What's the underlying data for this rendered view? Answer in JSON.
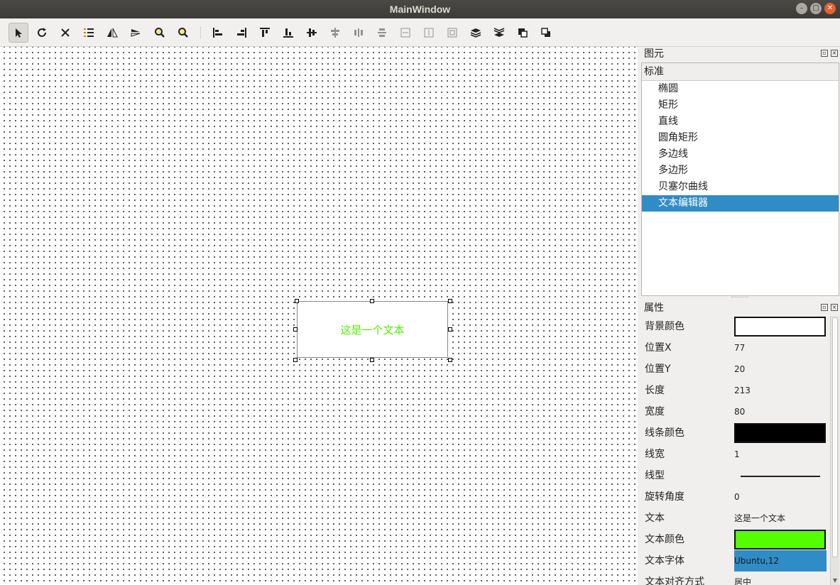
{
  "window": {
    "title": "MainWindow"
  },
  "toolbar": {
    "buttons": [
      {
        "icon": "select-arrow-icon",
        "active": true,
        "disabled": false
      },
      {
        "icon": "rotate-icon",
        "active": false,
        "disabled": false
      },
      {
        "icon": "delete-icon",
        "active": false,
        "disabled": false
      },
      {
        "icon": "list-icon",
        "active": false,
        "disabled": false
      },
      {
        "icon": "flip-horizontal-icon",
        "active": false,
        "disabled": false
      },
      {
        "icon": "flip-vertical-icon",
        "active": false,
        "disabled": false
      },
      {
        "icon": "zoom-in-icon",
        "active": false,
        "disabled": false
      },
      {
        "icon": "zoom-out-icon",
        "active": false,
        "disabled": false
      },
      {
        "icon": "align-left-icon",
        "active": false,
        "disabled": false
      },
      {
        "icon": "align-right-icon",
        "active": false,
        "disabled": false
      },
      {
        "icon": "align-top-icon",
        "active": false,
        "disabled": false
      },
      {
        "icon": "align-bottom-icon",
        "active": false,
        "disabled": false
      },
      {
        "icon": "align-horizontal-center-icon",
        "active": false,
        "disabled": false
      },
      {
        "icon": "align-vertical-center-icon",
        "active": false,
        "disabled": true
      },
      {
        "icon": "distribute-horizontal-icon",
        "active": false,
        "disabled": true
      },
      {
        "icon": "distribute-vertical-icon",
        "active": false,
        "disabled": true
      },
      {
        "icon": "same-width-icon",
        "active": false,
        "disabled": true
      },
      {
        "icon": "same-height-icon",
        "active": false,
        "disabled": true
      },
      {
        "icon": "same-size-icon",
        "active": false,
        "disabled": true
      },
      {
        "icon": "bring-to-front-icon",
        "active": false,
        "disabled": false
      },
      {
        "icon": "send-to-back-icon",
        "active": false,
        "disabled": false
      },
      {
        "icon": "group-icon",
        "active": false,
        "disabled": false
      },
      {
        "icon": "ungroup-icon",
        "active": false,
        "disabled": false
      }
    ]
  },
  "canvas": {
    "text_item": {
      "text": "这是一个文本",
      "color": "#55ee00"
    }
  },
  "elements_panel": {
    "title": "图元",
    "category": "标准",
    "items": [
      "椭圆",
      "矩形",
      "直线",
      "圆角矩形",
      "多边线",
      "多边形",
      "贝塞尔曲线",
      "文本编辑器"
    ],
    "selected_index": 7
  },
  "properties_panel": {
    "title": "属性",
    "rows": [
      {
        "name": "背景颜色",
        "type": "color",
        "value": "#ffffff"
      },
      {
        "name": "位置X",
        "type": "text",
        "value": "77"
      },
      {
        "name": "位置Y",
        "type": "text",
        "value": "20"
      },
      {
        "name": "长度",
        "type": "text",
        "value": "213"
      },
      {
        "name": "宽度",
        "type": "text",
        "value": "80"
      },
      {
        "name": "线条颜色",
        "type": "color",
        "value": "#000000"
      },
      {
        "name": "线宽",
        "type": "text",
        "value": "1"
      },
      {
        "name": "线型",
        "type": "line",
        "value": "solid"
      },
      {
        "name": "旋转角度",
        "type": "text",
        "value": "0"
      },
      {
        "name": "文本",
        "type": "text",
        "value": "这是一个文本"
      },
      {
        "name": "文本颜色",
        "type": "color",
        "value": "#55ff00"
      },
      {
        "name": "文本字体",
        "type": "font",
        "value": "Ubuntu,12"
      },
      {
        "name": "文本对齐方式",
        "type": "text",
        "value": "居中"
      }
    ]
  }
}
